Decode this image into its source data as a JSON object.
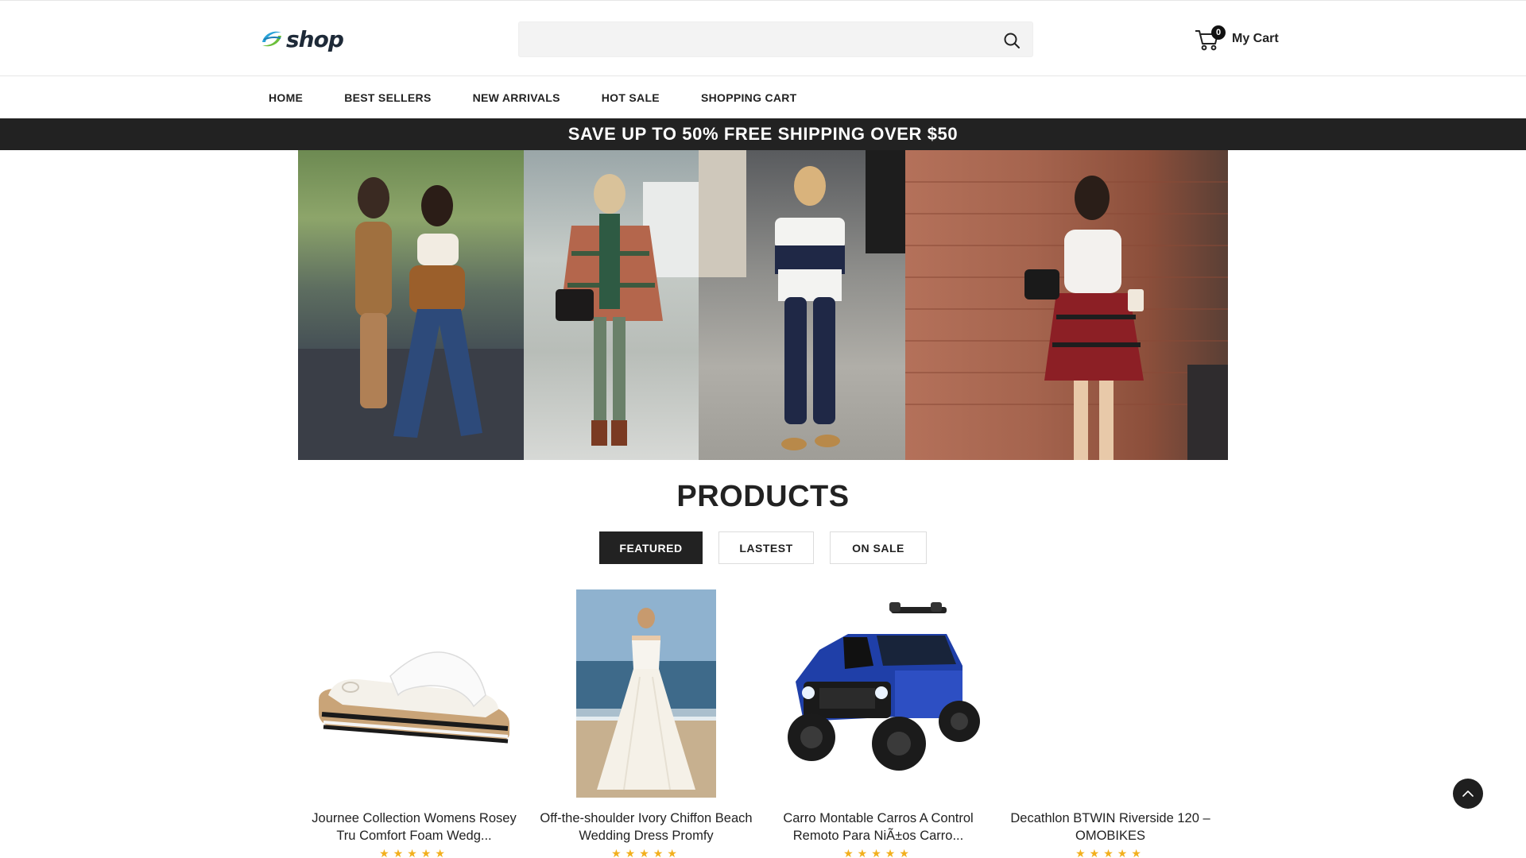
{
  "header": {
    "logo_text": "shop",
    "search": {
      "placeholder": "",
      "value": ""
    },
    "cart": {
      "count": "0",
      "label": "My Cart"
    }
  },
  "nav": {
    "items": [
      {
        "label": "HOME"
      },
      {
        "label": "BEST SELLERS"
      },
      {
        "label": "NEW ARRIVALS"
      },
      {
        "label": "HOT SALE"
      },
      {
        "label": "SHOPPING CART"
      }
    ]
  },
  "promo": {
    "text": "SAVE UP TO 50% FREE SHIPPING OVER $50"
  },
  "products": {
    "title": "PRODUCTS",
    "tabs": [
      {
        "label": "FEATURED",
        "active": true
      },
      {
        "label": "LASTEST",
        "active": false
      },
      {
        "label": "ON SALE",
        "active": false
      }
    ],
    "items": [
      {
        "name": "Journee Collection Womens Rosey Tru Comfort Foam Wedg...",
        "stars": "★★★★★",
        "image": "white-slide-sandal"
      },
      {
        "name": "Off-the-shoulder Ivory Chiffon Beach Wedding Dress Promfy",
        "stars": "★★★★★",
        "image": "wedding-dress-beach"
      },
      {
        "name": "Carro Montable Carros A Control Remoto Para NiÃ±os Carro...",
        "stars": "★★★★★",
        "image": "blue-ride-on-jeep"
      },
      {
        "name": "Decathlon BTWIN Riverside 120 – OMOBIKES",
        "stars": "★★★★★",
        "image": ""
      }
    ]
  },
  "colors": {
    "promo_bg": "#222222",
    "active_tab_bg": "#222222",
    "star": "#f2b01e",
    "search_bg": "#f3f3f3"
  },
  "icons": [
    "logo-mark-icon",
    "search-icon",
    "cart-icon",
    "chevron-up-icon"
  ]
}
